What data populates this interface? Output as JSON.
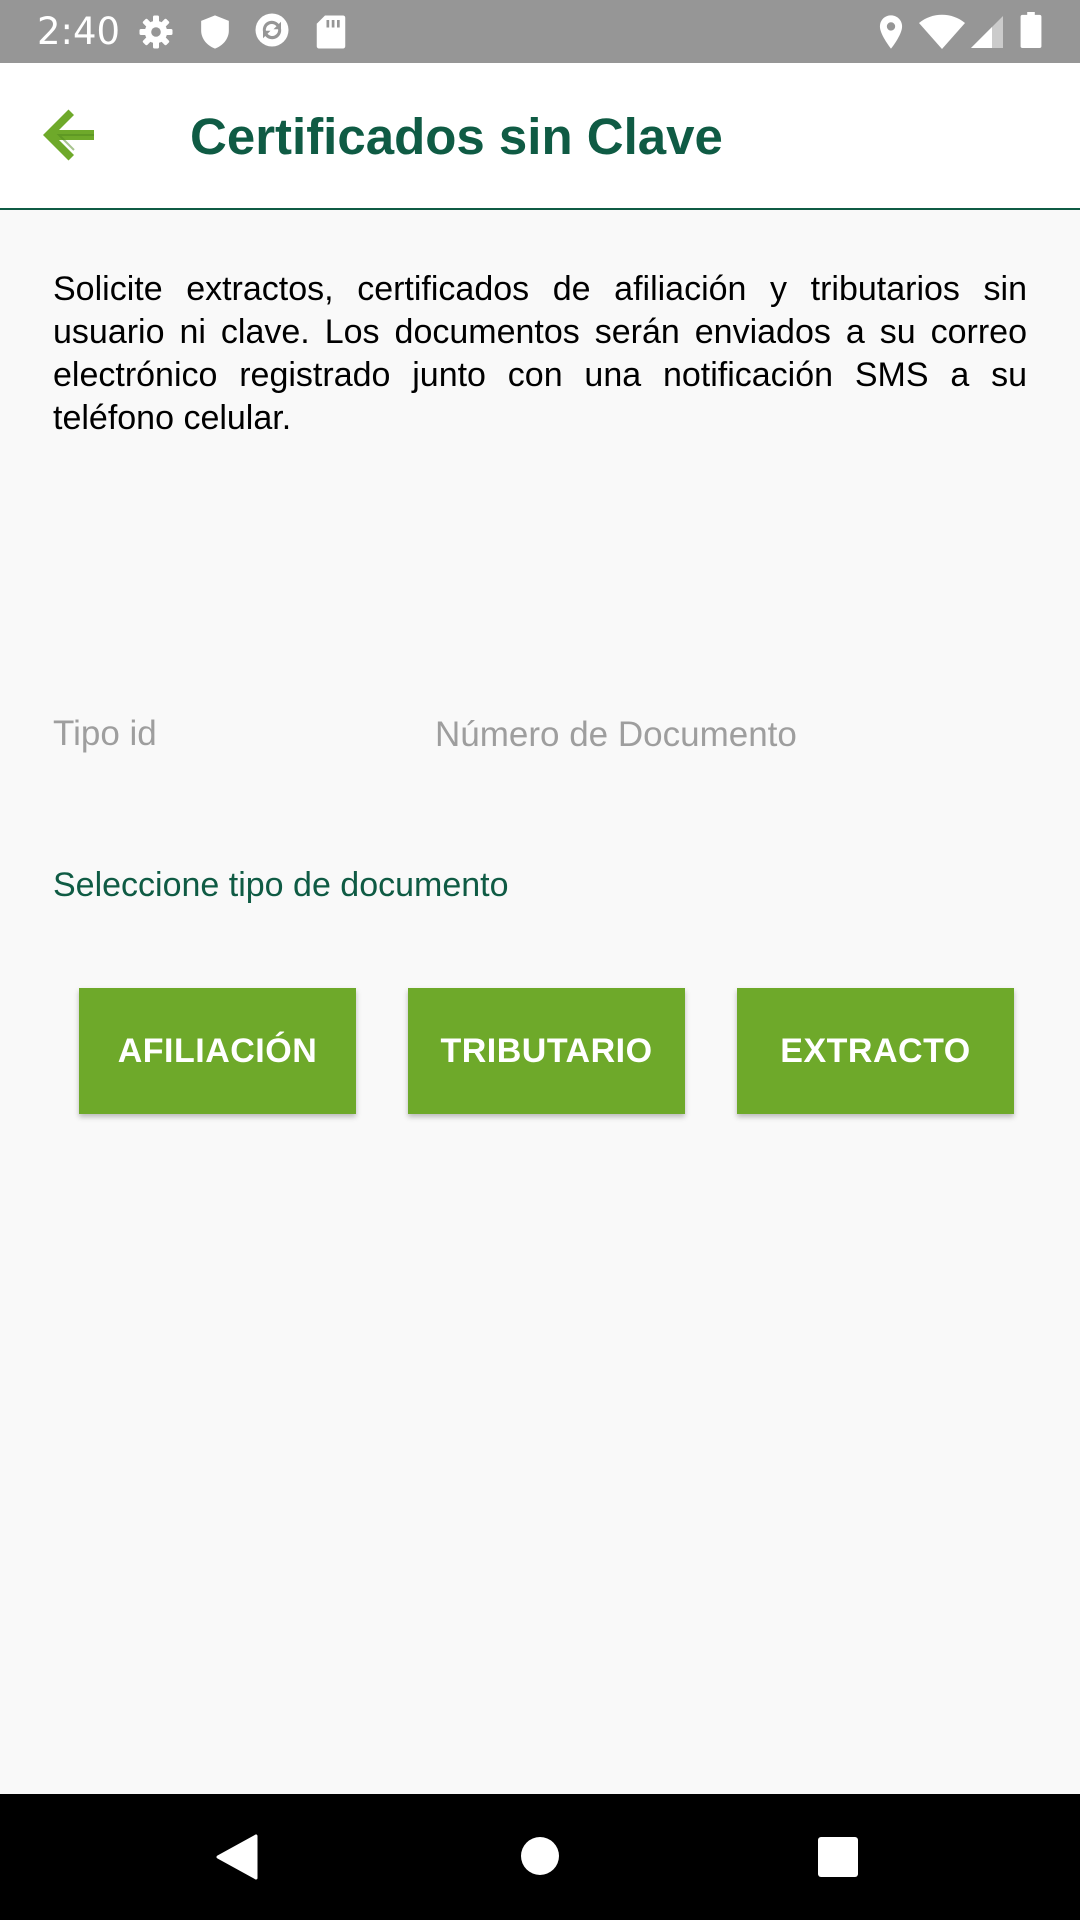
{
  "status_bar": {
    "time": "2:40",
    "left_icons": [
      "settings-icon",
      "shield-icon",
      "sync-icon",
      "sd-card-icon"
    ],
    "right_icons": [
      "location-icon",
      "wifi-icon",
      "signal-icon",
      "battery-icon"
    ]
  },
  "app_bar": {
    "title": "Certificados sin Clave",
    "back_icon": "arrow-left-icon",
    "accent_color": "#0f5b44",
    "icon_color": "#6ea92a"
  },
  "main": {
    "description": "Solicite extractos, certificados de afiliación y tributarios sin usuario ni clave. Los documentos serán enviados a su correo electrónico registrado junto con una notificación SMS a su teléfono celular.",
    "tipo_id": {
      "placeholder": "Tipo id"
    },
    "numero_documento": {
      "value": "",
      "placeholder": "Número de Documento"
    },
    "select_label": "Seleccione tipo de documento",
    "buttons": [
      {
        "label": "AFILIACIÓN"
      },
      {
        "label": "TRIBUTARIO"
      },
      {
        "label": "EXTRACTO"
      }
    ],
    "button_color": "#6ea92a"
  },
  "nav_bar": {
    "icons": [
      "back-triangle-icon",
      "home-circle-icon",
      "recents-square-icon"
    ]
  }
}
